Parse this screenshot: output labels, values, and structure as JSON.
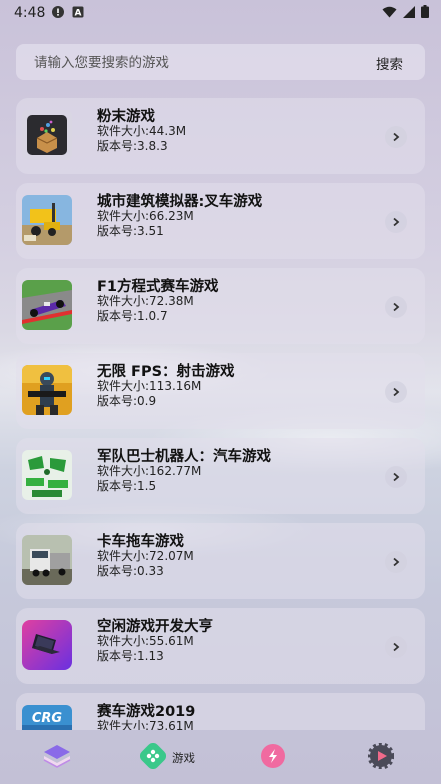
{
  "status": {
    "time": "4:48"
  },
  "search": {
    "placeholder": "请输入您要搜索的游戏",
    "button": "搜索"
  },
  "labels": {
    "size": "软件大小:",
    "version": "版本号:"
  },
  "games": [
    {
      "name": "粉末游戏",
      "size": "44.3M",
      "version": "3.8.3",
      "icon": "powder-game-icon"
    },
    {
      "name": "城市建筑模拟器:叉车游戏",
      "size": "66.23M",
      "version": "3.51",
      "icon": "forklift-game-icon"
    },
    {
      "name": "F1方程式赛车游戏",
      "size": "72.38M",
      "version": "1.0.7",
      "icon": "f1-racing-icon"
    },
    {
      "name": "无限 FPS：射击游戏",
      "size": "113.16M",
      "version": "0.9",
      "icon": "fps-shooter-icon"
    },
    {
      "name": "军队巴士机器人：汽车游戏",
      "size": "162.77M",
      "version": "1.5",
      "icon": "robot-car-icon"
    },
    {
      "name": "卡车拖车游戏",
      "size": "72.07M",
      "version": "0.33",
      "icon": "truck-trailer-icon"
    },
    {
      "name": "空闲游戏开发大亨",
      "size": "55.61M",
      "version": "1.13",
      "icon": "laptop-icon"
    },
    {
      "name": "赛车游戏2019",
      "size": "73.61M",
      "version": "",
      "icon": "crg-racing-icon"
    }
  ],
  "tabbar": {
    "games_label": "游戏"
  },
  "colors": {
    "accent": "#ffffff",
    "text": "#111111"
  }
}
